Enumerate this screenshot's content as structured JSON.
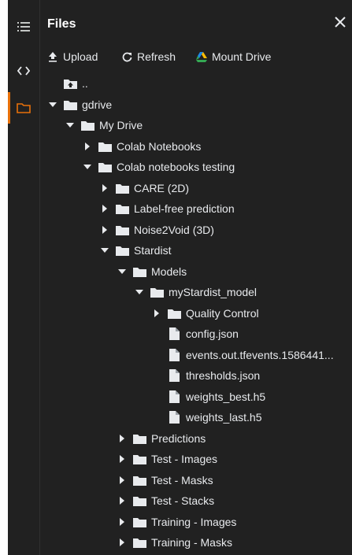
{
  "header": {
    "title": "Files"
  },
  "toolbar": {
    "upload": "Upload",
    "refresh": "Refresh",
    "mount": "Mount Drive"
  },
  "tree": [
    {
      "label": "..",
      "icon": "folder-up-icon",
      "caret": "none",
      "level": 0
    },
    {
      "label": "gdrive",
      "icon": "folder-icon",
      "caret": "down",
      "level": 0
    },
    {
      "label": "My Drive",
      "icon": "folder-icon",
      "caret": "down",
      "level": 1
    },
    {
      "label": "Colab Notebooks",
      "icon": "folder-icon",
      "caret": "right",
      "level": 2
    },
    {
      "label": "Colab notebooks testing",
      "icon": "folder-icon",
      "caret": "down",
      "level": 2
    },
    {
      "label": "CARE (2D)",
      "icon": "folder-icon",
      "caret": "right",
      "level": 3
    },
    {
      "label": "Label-free prediction",
      "icon": "folder-icon",
      "caret": "right",
      "level": 3
    },
    {
      "label": "Noise2Void (3D)",
      "icon": "folder-icon",
      "caret": "right",
      "level": 3
    },
    {
      "label": "Stardist",
      "icon": "folder-icon",
      "caret": "down",
      "level": 3
    },
    {
      "label": "Models",
      "icon": "folder-icon",
      "caret": "down",
      "level": 4
    },
    {
      "label": "myStardist_model",
      "icon": "folder-icon",
      "caret": "down",
      "level": 5
    },
    {
      "label": "Quality Control",
      "icon": "folder-icon",
      "caret": "right",
      "level": 6
    },
    {
      "label": "config.json",
      "icon": "file-icon",
      "caret": "none",
      "level": 6
    },
    {
      "label": "events.out.tfevents.1586441...",
      "icon": "file-icon",
      "caret": "none",
      "level": 6
    },
    {
      "label": "thresholds.json",
      "icon": "file-icon",
      "caret": "none",
      "level": 6
    },
    {
      "label": "weights_best.h5",
      "icon": "file-icon",
      "caret": "none",
      "level": 6
    },
    {
      "label": "weights_last.h5",
      "icon": "file-icon",
      "caret": "none",
      "level": 6
    },
    {
      "label": "Predictions",
      "icon": "folder-icon",
      "caret": "right",
      "level": 4
    },
    {
      "label": "Test - Images",
      "icon": "folder-icon",
      "caret": "right",
      "level": 4
    },
    {
      "label": "Test - Masks",
      "icon": "folder-icon",
      "caret": "right",
      "level": 4
    },
    {
      "label": "Test - Stacks",
      "icon": "folder-icon",
      "caret": "right",
      "level": 4
    },
    {
      "label": "Training - Images",
      "icon": "folder-icon",
      "caret": "right",
      "level": 4
    },
    {
      "label": "Training - Masks",
      "icon": "folder-icon",
      "caret": "right",
      "level": 4
    }
  ],
  "colors": {
    "background": "#212121",
    "text": "#e8eaed",
    "accent": "#e8710a"
  }
}
